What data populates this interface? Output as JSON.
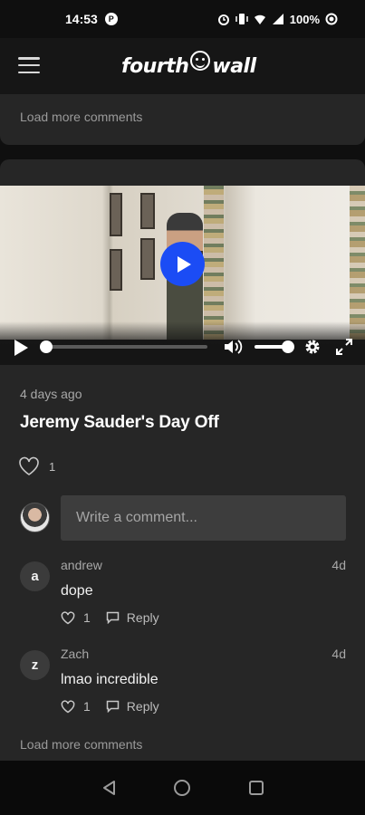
{
  "status_bar": {
    "time": "14:53",
    "left_icon": "P",
    "battery": "100%",
    "icons": [
      "alarm-icon",
      "vibrate-icon",
      "wifi-icon",
      "signal-icon",
      "battery-icon"
    ]
  },
  "header": {
    "logo_left": "fourth",
    "logo_right": "wall",
    "menu_icon": "hamburger-menu-icon"
  },
  "previous_post": {
    "load_more": "Load more comments"
  },
  "post": {
    "video": {
      "played_fraction": 0.0,
      "volume_fraction": 1.0
    },
    "time_ago": "4 days ago",
    "title": "Jeremy Sauder's Day Off",
    "like_count": "1",
    "comment_placeholder": "Write a comment...",
    "comments": [
      {
        "initial": "a",
        "user": "andrew",
        "age": "4d",
        "text": "dope",
        "likes": "1",
        "reply_label": "Reply"
      },
      {
        "initial": "z",
        "user": "Zach",
        "age": "4d",
        "text": "lmao incredible",
        "likes": "1",
        "reply_label": "Reply"
      }
    ],
    "load_more": "Load more comments"
  },
  "colors": {
    "accent": "#1b4cf5",
    "card": "#262626",
    "background": "#0f0f0f"
  }
}
